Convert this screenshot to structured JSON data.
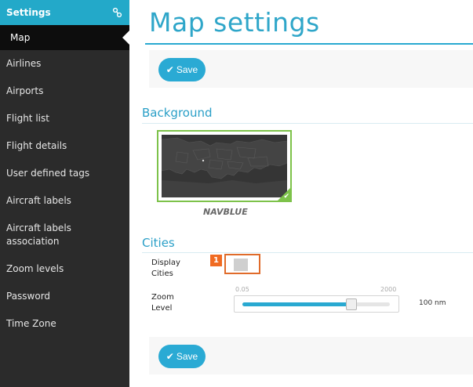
{
  "sidebar": {
    "header": "Settings",
    "header_icon": "settings-icon",
    "active": "Map",
    "items": [
      "Airlines",
      "Airports",
      "Flight list",
      "Flight details",
      "User defined tags",
      "Aircraft labels",
      "Aircraft labels association",
      "Zoom levels",
      "Password",
      "Time Zone"
    ]
  },
  "main": {
    "title": "Map settings",
    "save_label": "Save",
    "background": {
      "section_title": "Background",
      "map_name": "NAVBLUE",
      "selected": true
    },
    "cities": {
      "section_title": "Cities",
      "display_label": "Display Cities",
      "display_value": false,
      "annotation_badge": "1",
      "zoom_label": "Zoom Level",
      "zoom_min": "0.05",
      "zoom_max": "2000",
      "zoom_fraction": 0.72,
      "zoom_value": "100 nm"
    }
  },
  "colors": {
    "accent": "#2aaad4",
    "sidebar_bg": "#2b2b2b",
    "selected_border": "#7dc24a",
    "highlight": "#e06b2a"
  }
}
